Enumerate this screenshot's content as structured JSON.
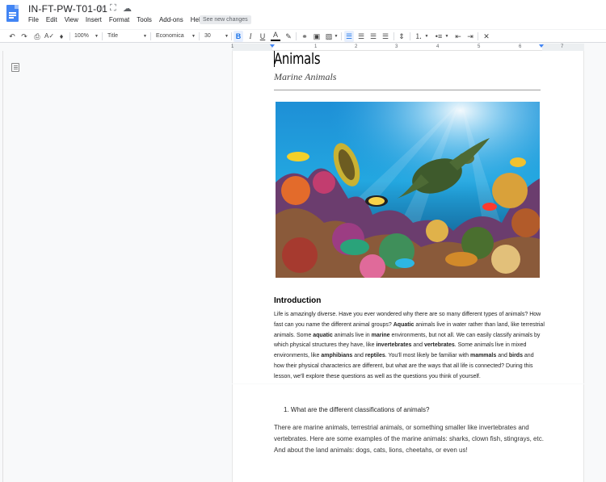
{
  "app": {
    "doc_title": "IN-FT-PW-T01-01",
    "menu": [
      "File",
      "Edit",
      "View",
      "Insert",
      "Format",
      "Tools",
      "Add-ons",
      "Help"
    ],
    "see_changes": "See new changes"
  },
  "toolbar": {
    "zoom": "100%",
    "style": "Title",
    "font": "Economica",
    "size": "30"
  },
  "ruler": {
    "numbers": [
      "1",
      "1",
      "2",
      "3",
      "4",
      "5",
      "6",
      "7"
    ]
  },
  "document": {
    "title": "Animals",
    "subtitle": "Marine Animals",
    "intro_heading": "Introduction",
    "intro_segments": [
      {
        "t": "Life is amazingly diverse. Have you ever wondered why there are so many different types of animals? How fast can you name the different animal groups? ",
        "b": false
      },
      {
        "t": "Aquatic",
        "b": true
      },
      {
        "t": " animals live in water rather than land, like terrestrial animals. Some ",
        "b": false
      },
      {
        "t": "aquatic",
        "b": true
      },
      {
        "t": " animals live in ",
        "b": false
      },
      {
        "t": "marine",
        "b": true
      },
      {
        "t": " environments, but not all. We can easily classify animals by which physical structures they have, like ",
        "b": false
      },
      {
        "t": "invertebrates",
        "b": true
      },
      {
        "t": " and ",
        "b": false
      },
      {
        "t": "vertebrates",
        "b": true
      },
      {
        "t": ". Some animals live in mixed environments, like ",
        "b": false
      },
      {
        "t": "amphibians",
        "b": true
      },
      {
        "t": " and ",
        "b": false
      },
      {
        "t": "reptiles",
        "b": true
      },
      {
        "t": ". You'll most likely be familiar with ",
        "b": false
      },
      {
        "t": "mammals",
        "b": true
      },
      {
        "t": " and ",
        "b": false
      },
      {
        "t": "birds",
        "b": true
      },
      {
        "t": " and how their physical characterics are different, but what are the ways that all life is connected? During this lesson, we'll explore these questions as well as the questions you think of yourself.",
        "b": false
      }
    ],
    "list_item": "1.   What are the different classifications of animals?",
    "answer": "There are marine animals, terrestrial animals, or something smaller like invertebrates and vertebrates. Here are some examples of the marine animals: sharks, clown fish, stingrays, etc. And about the land animals: dogs, cats, lions, cheetahs, or even us!"
  },
  "icons": [
    "docs-logo-icon",
    "star-icon",
    "move-icon",
    "cloud-icon",
    "undo-icon",
    "redo-icon",
    "print-icon",
    "spellcheck-icon",
    "paint-format-icon",
    "bold-icon",
    "italic-icon",
    "underline-icon",
    "text-color-icon",
    "highlight-icon",
    "link-icon",
    "comment-icon",
    "image-icon",
    "align-left-icon",
    "align-center-icon",
    "align-right-icon",
    "align-justify-icon",
    "line-spacing-icon",
    "numbered-list-icon",
    "bulleted-list-icon",
    "decrease-indent-icon",
    "increase-indent-icon",
    "clear-format-icon",
    "outline-icon"
  ],
  "colors": {
    "accent": "#1a73e8",
    "docs_blue": "#4285f4"
  }
}
